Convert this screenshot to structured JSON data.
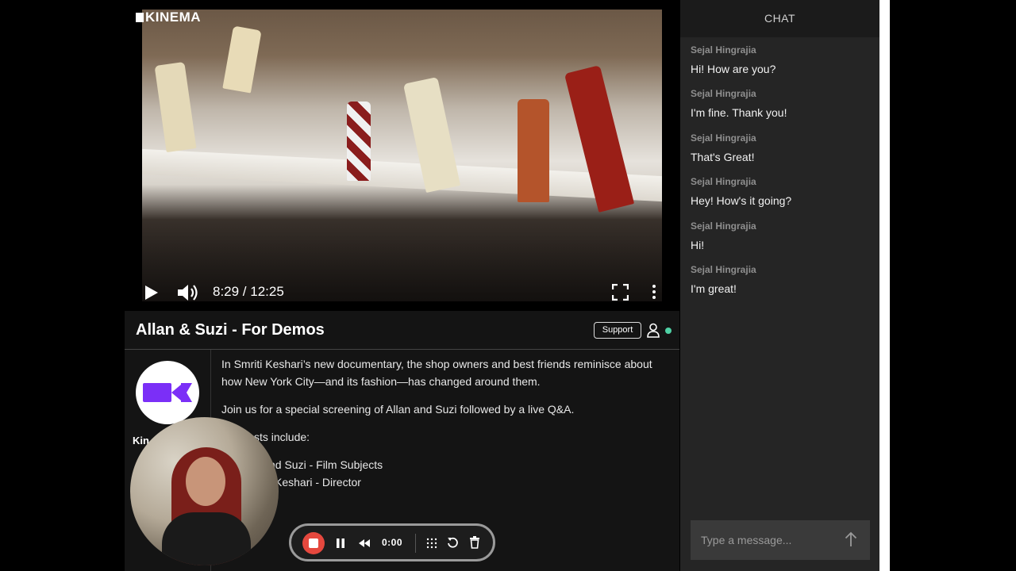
{
  "brand": {
    "logo_text": "KINEMA"
  },
  "player": {
    "time_display": "8:29 / 12:25",
    "progress_fraction": 0.68
  },
  "event": {
    "title": "Allan & Suzi - For Demos",
    "support_label": "Support",
    "org_name_partial": "Kin",
    "description": [
      "In Smriti Keshari’s new documentary, the shop owners and best friends reminisce about how New York City—and its fashion—has changed around them.",
      "Join us for a special screening of Allan and Suzi followed by a live Q&A."
    ],
    "guests_intro_partial": "sts include:",
    "guests_partial": [
      "nd Suzi - Film Subjects",
      "Keshari - Director"
    ]
  },
  "recorder": {
    "time": "0:00",
    "accent": "#e5483e"
  },
  "chat": {
    "header": "CHAT",
    "messages": [
      {
        "author": "Sejal Hingrajia",
        "text": "Hi! How are you?"
      },
      {
        "author": "Sejal Hingrajia",
        "text": "I'm fine. Thank you!"
      },
      {
        "author": "Sejal Hingrajia",
        "text": "That's Great!"
      },
      {
        "author": "Sejal Hingrajia",
        "text": "Hey! How's it going?"
      },
      {
        "author": "Sejal Hingrajia",
        "text": "Hi!"
      },
      {
        "author": "Sejal Hingrajia",
        "text": "I'm great!"
      }
    ],
    "input_placeholder": "Type a message..."
  },
  "colors": {
    "online": "#4fd1a5",
    "brand_purple": "#7b2ff7"
  }
}
